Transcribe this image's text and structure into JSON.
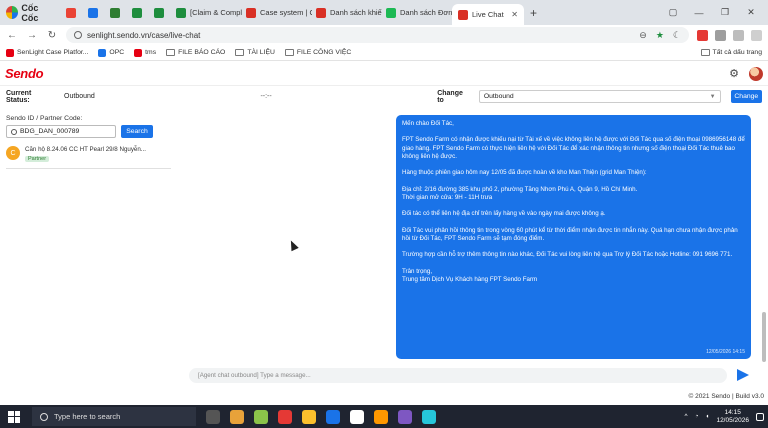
{
  "browser": {
    "brand": "Cốc Cốc",
    "tabs": [
      {
        "label": "",
        "color": "#ea4335",
        "active": false
      },
      {
        "label": "",
        "color": "#1a73e8",
        "active": false
      },
      {
        "label": "",
        "color": "#2e7d32",
        "active": false
      },
      {
        "label": "",
        "color": "#1e8e3e",
        "active": false
      },
      {
        "label": "",
        "color": "#1e8e3e",
        "active": false
      },
      {
        "label": "[Claim & Compla",
        "color": "#1e8e3e",
        "active": false
      },
      {
        "label": "Case system | Ca",
        "color": "#d93025",
        "active": false
      },
      {
        "label": "Danh sách khiếu",
        "color": "#d93025",
        "active": false
      },
      {
        "label": "Danh sách Đơn t",
        "color": "#1db954",
        "active": false
      },
      {
        "label": "Live Chat",
        "color": "#d93025",
        "active": true
      }
    ],
    "new_tab": "+",
    "url": "senlight.sendo.vn/case/live-chat",
    "bookmarks": [
      {
        "label": "SenLight Case Platfor...",
        "type": "site",
        "color": "#e60012"
      },
      {
        "label": "OPC",
        "type": "site",
        "color": "#1a73e8"
      },
      {
        "label": "tms",
        "type": "site",
        "color": "#e60012"
      },
      {
        "label": "FILE BÁO CÁO",
        "type": "folder"
      },
      {
        "label": "TÀI LIỆU",
        "type": "folder"
      },
      {
        "label": "FILE CÔNG VIỆC",
        "type": "folder"
      }
    ],
    "all_bookmarks": "Tất cả dấu trang"
  },
  "app": {
    "logo": "Sendo",
    "status_label": "Current Status:",
    "status_value": "Outbound",
    "timer": "--:--",
    "change_to_label": "Change to",
    "change_to_value": "Outbound",
    "change_button": "Change"
  },
  "search": {
    "label": "Sendo ID / Partner Code:",
    "value": "BDG_DAN_000789",
    "button": "Search"
  },
  "case_item": {
    "initial": "C",
    "title": "Căn hộ 8.24.06 CC HT Pearl 29/8 Nguyễn...",
    "tag": "Partner"
  },
  "message": {
    "paragraphs": [
      "Mến chào Đối Tác,",
      "FPT Sendo Farm có nhận được khiếu nại từ Tài xế về việc không liên hệ được với Đối Tác qua số điện thoại 0986956148 để giao hàng. FPT Sendo Farm có thực hiện liên hệ với Đối Tác để xác nhận thông tin nhưng số điện thoại Đối Tác thuê bao không liên hệ được.",
      "Hàng thuộc phiên giao hôm nay 12/05 đã được hoàn về kho Man Thiện (grid Man Thiện):",
      "Địa chỉ: 2/16 đường 385 khu phố 2, phường Tăng Nhơn Phú A, Quận 9, Hồ Chí Minh.\nThời gian mở cửa: 9H - 11H trưa",
      "Đối tác có thể liên hệ địa chỉ trên lấy hàng về vào ngày mai được không ạ.",
      "Đối Tác vui phản hồi thông tin trong vòng 60 phút kể từ thời điểm nhận được tin nhắn này. Quá hạn chưa nhận được phản hồi từ Đối Tác, FPT Sendo Farm sẽ tạm đóng điểm.",
      "Trường hợp cần hỗ trợ thêm thông tin nào khác, Đối Tác vui lòng liên hệ qua Trợ lý Đối Tác hoặc Hotline: 091 9696 771.",
      "Trân trọng,\nTrung tâm Dịch Vụ Khách hàng FPT Sendo Farm"
    ],
    "timestamp": "12/05/2026 14:15",
    "input_placeholder": "[Agent chat outbound] Type a message..."
  },
  "footer": "© 2021 Sendo | Build v3.0",
  "taskbar": {
    "search_placeholder": "Type here to search",
    "time": "14:15",
    "date": "12/05/2026",
    "app_colors": [
      "#555555",
      "#e8a23a",
      "#8bc34a",
      "#e53935",
      "#fbc02d",
      "#1a73e8",
      "#ffffff",
      "#ff9800",
      "#7e57c2",
      "#26c6da"
    ]
  },
  "colors": {
    "accent": "#1a73e8",
    "brand": "#e60012"
  }
}
